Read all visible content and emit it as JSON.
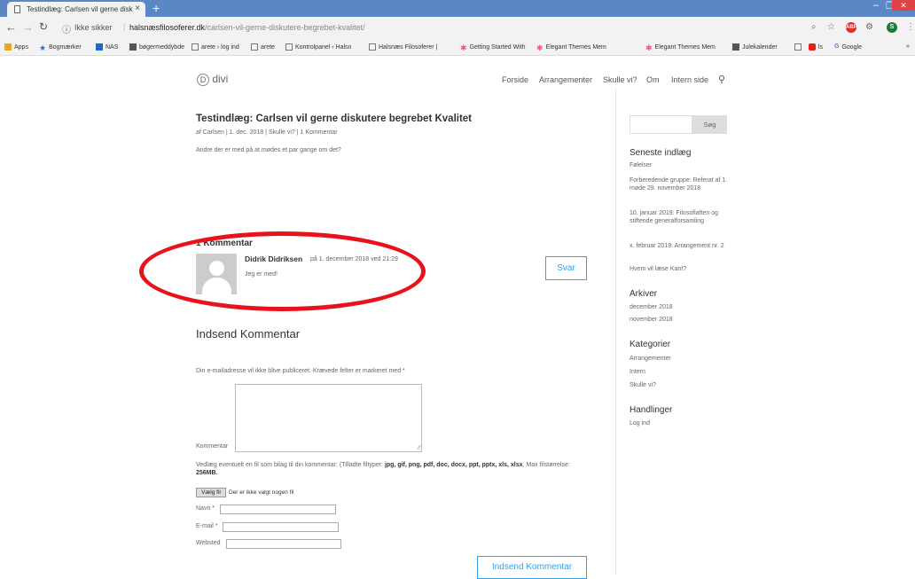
{
  "browser": {
    "tab_title": "Testindlæg: Carlsen vil gerne disk",
    "new_tab": "+",
    "secure_label": "Ikke sikker",
    "url_domain": "halsnæsfilosoferer.dk",
    "url_path": "/carlsen-vil-gerne-diskutere-begrebet-kvalitet/",
    "profile_initial": "S",
    "bookmarks": [
      {
        "label": "Apps",
        "icon": "apps-grid-icon",
        "color": "#e8a623"
      },
      {
        "label": "Bogmærker",
        "icon": "star-icon",
        "color": "#1a73e8"
      },
      {
        "label": "NAS",
        "icon": "nas-icon",
        "color": "#1b6ac9"
      },
      {
        "label": "bøgermeddybde",
        "icon": "site-icon",
        "color": "#555555"
      },
      {
        "label": "arete › log ind",
        "icon": "page-icon",
        "color": "#777777"
      },
      {
        "label": "arete",
        "icon": "page-icon",
        "color": "#777777"
      },
      {
        "label": "Kontrolpanel ‹ Halsn",
        "icon": "page-icon",
        "color": "#777777"
      },
      {
        "label": "Halsnæs Filosoferer |",
        "icon": "page-icon",
        "color": "#777777"
      },
      {
        "label": "Getting Started With",
        "icon": "asterisk-icon",
        "color": "#e35e88"
      },
      {
        "label": "Elegant Themes Mem",
        "icon": "asterisk-icon",
        "color": "#e35e88"
      },
      {
        "label": "Elegant Themes Mem",
        "icon": "asterisk-icon",
        "color": "#e35e88"
      },
      {
        "label": "Julekalender",
        "icon": "site-icon",
        "color": "#555555"
      },
      {
        "label": "",
        "icon": "page-icon",
        "color": "#777777"
      },
      {
        "label": "ls",
        "icon": "youtube-icon",
        "color": "#e62117"
      },
      {
        "label": "Google",
        "icon": "google-icon",
        "color": "#4285f4"
      }
    ]
  },
  "site": {
    "logo_text": "divi",
    "logo_letter": "D",
    "menu": [
      "Forside",
      "Arrangementer",
      "Skulle vi?",
      "Om",
      "Intern side"
    ]
  },
  "post": {
    "title": "Testindlæg: Carlsen vil gerne diskutere begrebet Kvalitet",
    "meta": "af Carlsen | 1. dec. 2018 | Skulle vi? | 1 Kommentar",
    "body": "Andre der er med på at mødes et par gange om det?"
  },
  "comments": {
    "heading": "1 Kommentar",
    "items": [
      {
        "author": "Didrik Didriksen",
        "date": "på 1. december 2018 ved 21:29",
        "text": "Jeg er med!",
        "reply_label": "Svar"
      }
    ]
  },
  "form": {
    "title": "Indsend Kommentar",
    "note": "Din e-mailadresse vil ikke blive publiceret. Krævede felter er markeret med *",
    "comment_label": "Kommentar",
    "attach_text": "Vedlæg eventuelt en fil som bilag til din kommentar:  (Tilladte filtyper: ",
    "attach_types": "jpg, gif, png, pdf, doc, docx, ppt, pptx, xls, xlsx",
    "attach_text2": ", Max filstørrelse: ",
    "attach_size": "256MB.",
    "file_button": "Vælg fil",
    "file_none": "Der er ikke valgt nogen fil",
    "name_label": "Navn *",
    "email_label": "E-mail *",
    "website_label": "Websted",
    "submit_label": "Indsend Kommentar"
  },
  "sidebar": {
    "search_button": "Søg",
    "recent_title": "Seneste indlæg",
    "recent": [
      "Følelser",
      "Forberedende gruppe: Referat af 1. møde 29. november 2018",
      "10. januar 2019: Filosofiaften og stiftende generalforsamling",
      "x. februar 2019: Arrangement nr. 2",
      "Hvem vil læse Kant?"
    ],
    "archive_title": "Arkiver",
    "archives": [
      "december 2018",
      "november 2018"
    ],
    "categories_title": "Kategorier",
    "categories": [
      "Arrangementer",
      "Intern",
      "Skulle vi?"
    ],
    "actions_title": "Handlinger",
    "actions": [
      "Log ind"
    ]
  },
  "annotation": {
    "color": "#e8121b"
  }
}
